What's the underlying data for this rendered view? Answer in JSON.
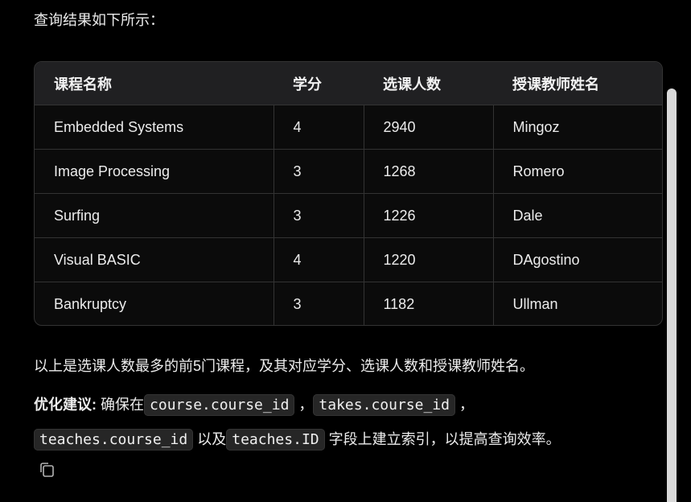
{
  "intro_text": "查询结果如下所示：",
  "table": {
    "headers": [
      "课程名称",
      "学分",
      "选课人数",
      "授课教师姓名"
    ],
    "rows": [
      [
        "Embedded Systems",
        "4",
        "2940",
        "Mingoz"
      ],
      [
        "Image Processing",
        "3",
        "1268",
        "Romero"
      ],
      [
        "Surfing",
        "3",
        "1226",
        "Dale"
      ],
      [
        "Visual BASIC",
        "4",
        "1220",
        "DAgostino"
      ],
      [
        "Bankruptcy",
        "3",
        "1182",
        "Ullman"
      ]
    ]
  },
  "summary_text": "以上是选课人数最多的前5门课程，及其对应学分、选课人数和授课教师姓名。",
  "tip": {
    "label": "优化建议:",
    "prefix": " 确保在",
    "code1": "course.course_id",
    "sep1": " ，",
    "code2": "takes.course_id",
    "sep2": " ，",
    "code3": "teaches.course_id",
    "mid": " 以及",
    "code4": "teaches.ID",
    "suffix": " 字段上建立索引，以提高查询效率。"
  },
  "icons": {
    "copy": "copy-icon"
  },
  "colors": {
    "background": "#000000",
    "header_bg": "#202022",
    "border": "#333333",
    "text": "#ececec"
  }
}
